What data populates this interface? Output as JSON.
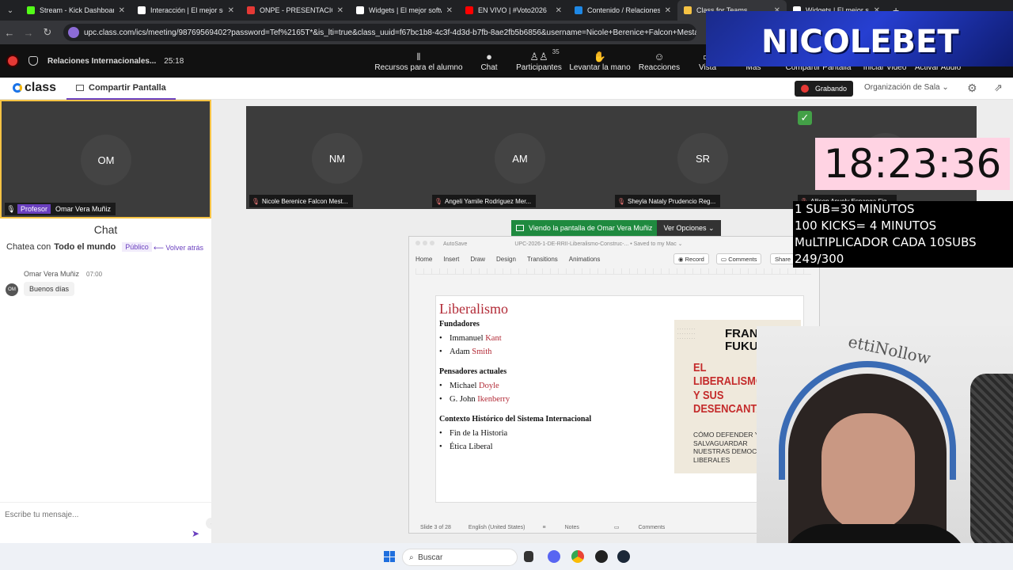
{
  "browser": {
    "tabs": [
      {
        "title": "Stream - Kick Dashboard",
        "color": "#53fc18",
        "active": false
      },
      {
        "title": "Interacción | El mejor softw",
        "color": "#ffffff",
        "active": false
      },
      {
        "title": "ONPE - PRESENTACIÓN D",
        "color": "#e53935",
        "active": false
      },
      {
        "title": "Widgets | El mejor softw",
        "color": "#ffffff",
        "active": false
      },
      {
        "title": "EN VIVO | #Voto2026",
        "color": "#ff0000",
        "active": false
      },
      {
        "title": "Contenido / Relaciones In",
        "color": "#1e88e5",
        "active": false
      },
      {
        "title": "Class for Teams",
        "color": "#f6c344",
        "active": true
      },
      {
        "title": "Widgets | El mejor softw",
        "color": "#ffffff",
        "active": false
      }
    ],
    "url": "upc.class.com/ics/meeting/98769569402?password=Tef%2165T*&is_lti=true&class_uuid=f67bc1b8-4c3f-4d3d-b7fb-8ae2fb5b6856&username=Nicole+Berenice+Falcon+Mestanza"
  },
  "meeting": {
    "title": "Relaciones Internacionales...",
    "elapsed": "25:18",
    "toolbar": [
      {
        "label": "Recursos para el alumno",
        "icon": "books-icon",
        "glyph": "𝍪"
      },
      {
        "label": "Chat",
        "icon": "chat-icon",
        "glyph": "●"
      },
      {
        "label": "Participantes",
        "icon": "participants-icon",
        "glyph": "♙♙",
        "badge": "35"
      },
      {
        "label": "Levantar la mano",
        "icon": "hand-icon",
        "glyph": "✋"
      },
      {
        "label": "Reacciones",
        "icon": "reactions-icon",
        "glyph": "☺"
      },
      {
        "label": "Vista",
        "icon": "view-icon",
        "glyph": "▭"
      },
      {
        "label": "Más",
        "icon": "more-icon",
        "glyph": "⋯"
      },
      {
        "label": "Compartir Pantalla",
        "icon": "share-screen-icon",
        "glyph": "▭"
      },
      {
        "label": "Iniciar Video",
        "icon": "video-icon",
        "glyph": "▶"
      },
      {
        "label": "Activar Audio",
        "icon": "mic-icon",
        "glyph": "♪"
      }
    ]
  },
  "classbar": {
    "logo": "class",
    "share_tab": "Compartir Pantalla",
    "recording": "Grabando",
    "org": "Organización de Sala"
  },
  "professor": {
    "initials": "OM",
    "role": "Profesor",
    "name": "Omar Vera Muñiz"
  },
  "participants": [
    {
      "initials": "NM",
      "name": "Nicole Berenice Falcon Mest..."
    },
    {
      "initials": "AM",
      "name": "Angeli Yamile Rodriguez Mer..."
    },
    {
      "initials": "SR",
      "name": "Sheyla Nataly Prudencio Reg..."
    },
    {
      "initials": "",
      "name": "Allison Anyely Espanga Fig..."
    }
  ],
  "chat": {
    "title": "Chat",
    "with_label": "Chatea con",
    "with_target": "Todo el mundo",
    "visibility": "Público",
    "back": "Volver atrás",
    "messages": [
      {
        "avatar": "OM",
        "author": "Omar Vera Muñiz",
        "time": "07:00",
        "text": "Buenos días"
      }
    ],
    "input_placeholder": "Escribe tu mensaje..."
  },
  "share": {
    "viewing": "Viendo la pantalla de Omar Vera Muñiz",
    "options": "Ver Opciones"
  },
  "ppt": {
    "autosave": "AutoSave",
    "filename": "UPC-2026-1-DE-RRII-Liberalismo-Construc-...  •  Saved to my Mac ⌄",
    "ribbon": [
      "Home",
      "Insert",
      "Draw",
      "Design",
      "Transitions",
      "Animations"
    ],
    "record": "Record",
    "comments": "Comments",
    "share": "Share",
    "status": {
      "slide": "Slide 3 of 28",
      "lang": "English (United States)",
      "notes": "Notes",
      "comments": "Comments"
    },
    "slide": {
      "title": "Liberalismo",
      "sections": [
        {
          "heading": "Fundadores",
          "items": [
            {
              "first": "Immanuel",
              "last": "Kant"
            },
            {
              "first": "Adam",
              "last": "Smith"
            }
          ]
        },
        {
          "heading": "Pensadores actuales",
          "items": [
            {
              "first": "Michael",
              "last": "Doyle"
            },
            {
              "first": "G. John",
              "last": "Ikenberry"
            }
          ]
        },
        {
          "heading": "Contexto Histórico del Sistema Internacional",
          "items": [
            {
              "first": "Fin de la Historia",
              "last": ""
            },
            {
              "first": "Ética Liberal",
              "last": ""
            }
          ]
        }
      ],
      "book": {
        "author": "FRANC\nFUKUYA",
        "title": "EL\nLIBERALISMO\nY SUS\nDESENCANTAD",
        "subtitle": "CÓMO DEFENDER Y\nSALVAGUARDAR\nNUESTRAS DEMOCRACIA\nLIBERALES"
      }
    }
  },
  "overlays": {
    "brand": "NICOLEBET",
    "clock": "18:23:36",
    "rules": [
      "1 SUB=30 MINUTOS",
      "100 KICKS= 4 MINUTOS",
      "MuLTIPLICADOR CADA 10SUBS",
      "249/300"
    ],
    "wall_text": "ettiNollow"
  },
  "taskbar": {
    "search": "Buscar"
  }
}
